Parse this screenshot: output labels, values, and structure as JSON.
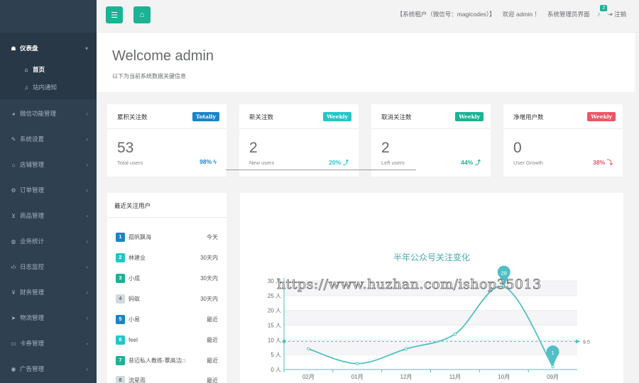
{
  "sidebar": {
    "dashboard": {
      "label": "仪表盘",
      "icon": "dashboard-icon"
    },
    "sub": [
      {
        "label": "首页",
        "icon": "home-icon",
        "active": true
      },
      {
        "label": "站内通知",
        "icon": "bell-icon",
        "active": false
      }
    ],
    "items": [
      {
        "label": "微信功能管理",
        "icon": "wechat-icon"
      },
      {
        "label": "系统设置",
        "icon": "wrench-icon"
      },
      {
        "label": "店铺管理",
        "icon": "store-icon"
      },
      {
        "label": "订单管理",
        "icon": "cogs-icon"
      },
      {
        "label": "商品管理",
        "icon": "cart-icon"
      },
      {
        "label": "业务统计",
        "icon": "globe-icon"
      },
      {
        "label": "日志监控",
        "icon": "code-icon"
      },
      {
        "label": "财务管理",
        "icon": "yen-icon"
      },
      {
        "label": "物流管理",
        "icon": "send-icon"
      },
      {
        "label": "卡券管理",
        "icon": "card-icon"
      },
      {
        "label": "广告管理",
        "icon": "ad-icon"
      }
    ]
  },
  "topbar": {
    "tenant": "【系统租户（微信号：magicodes）】",
    "welcome": "欢迎 admin ！",
    "admin_link": "系统管理员界面",
    "badge": "2",
    "logout": "注销"
  },
  "welcome": {
    "title": "Welcome admin",
    "subtitle": "以下为当前系统数据关键信息"
  },
  "stats": [
    {
      "title": "累积关注数",
      "label": "Totally",
      "label_color": "#1c84c6",
      "value": "53",
      "sub": "Total users",
      "pct": "98% ϟ",
      "pct_color": "#1c84c6"
    },
    {
      "title": "新关注数",
      "label": "Weekly",
      "label_color": "#23c6c8",
      "value": "2",
      "sub": "New users",
      "pct": "20% ⤴",
      "pct_color": "#23c6c8"
    },
    {
      "title": "取消关注数",
      "label": "Weekly",
      "label_color": "#1ab394",
      "value": "2",
      "sub": "Left users",
      "pct": "44% ⤴",
      "pct_color": "#1ab394"
    },
    {
      "title": "净增用户数",
      "label": "Weekly",
      "label_color": "#ed5565",
      "value": "0",
      "sub": "User Growth",
      "pct": "38% ⤵",
      "pct_color": "#ed5565"
    }
  ],
  "recent": {
    "title": "最近关注用户",
    "items": [
      {
        "idx": "1",
        "name": "孤帆飘海",
        "time": "今天",
        "color": "#1c84c6"
      },
      {
        "idx": "2",
        "name": "林建业",
        "time": "30天内",
        "color": "#23c6c8"
      },
      {
        "idx": "3",
        "name": "小成",
        "time": "30天内",
        "color": "#1ab394"
      },
      {
        "idx": "4",
        "name": "蚂蚁",
        "time": "30天内",
        "color": "#d1dade"
      },
      {
        "idx": "5",
        "name": "小易",
        "time": "最近",
        "color": "#1c84c6"
      },
      {
        "idx": "6",
        "name": "feel",
        "time": "最近",
        "color": "#23c6c8"
      },
      {
        "idx": "7",
        "name": "昔迈私人教练-覃高洁□",
        "time": "最近",
        "color": "#1ab394"
      },
      {
        "idx": "8",
        "name": "流星雨",
        "time": "最近",
        "color": "#d1dade"
      }
    ]
  },
  "chart_data": {
    "type": "line",
    "title": "半年公众号关注变化",
    "categories": [
      "02月",
      "01月",
      "12月",
      "11月",
      "10月",
      "09月"
    ],
    "series": [
      {
        "values": [
          7,
          2,
          7,
          12,
          28,
          1
        ]
      }
    ],
    "ylim": [
      0,
      30
    ],
    "yticks": [
      "0 人",
      "5 人",
      "10 人",
      "15 人",
      "20 人",
      "25 人",
      "30 人"
    ],
    "markpoints": [
      {
        "label": "28",
        "value": 28,
        "category": "10月"
      },
      {
        "label": "1",
        "value": 1,
        "category": "09月"
      }
    ],
    "markline": {
      "label": "9.5",
      "value": 9.5
    },
    "color": "#4ec0c6"
  },
  "watermark": "https://www.huzhan.com/ishop35013"
}
